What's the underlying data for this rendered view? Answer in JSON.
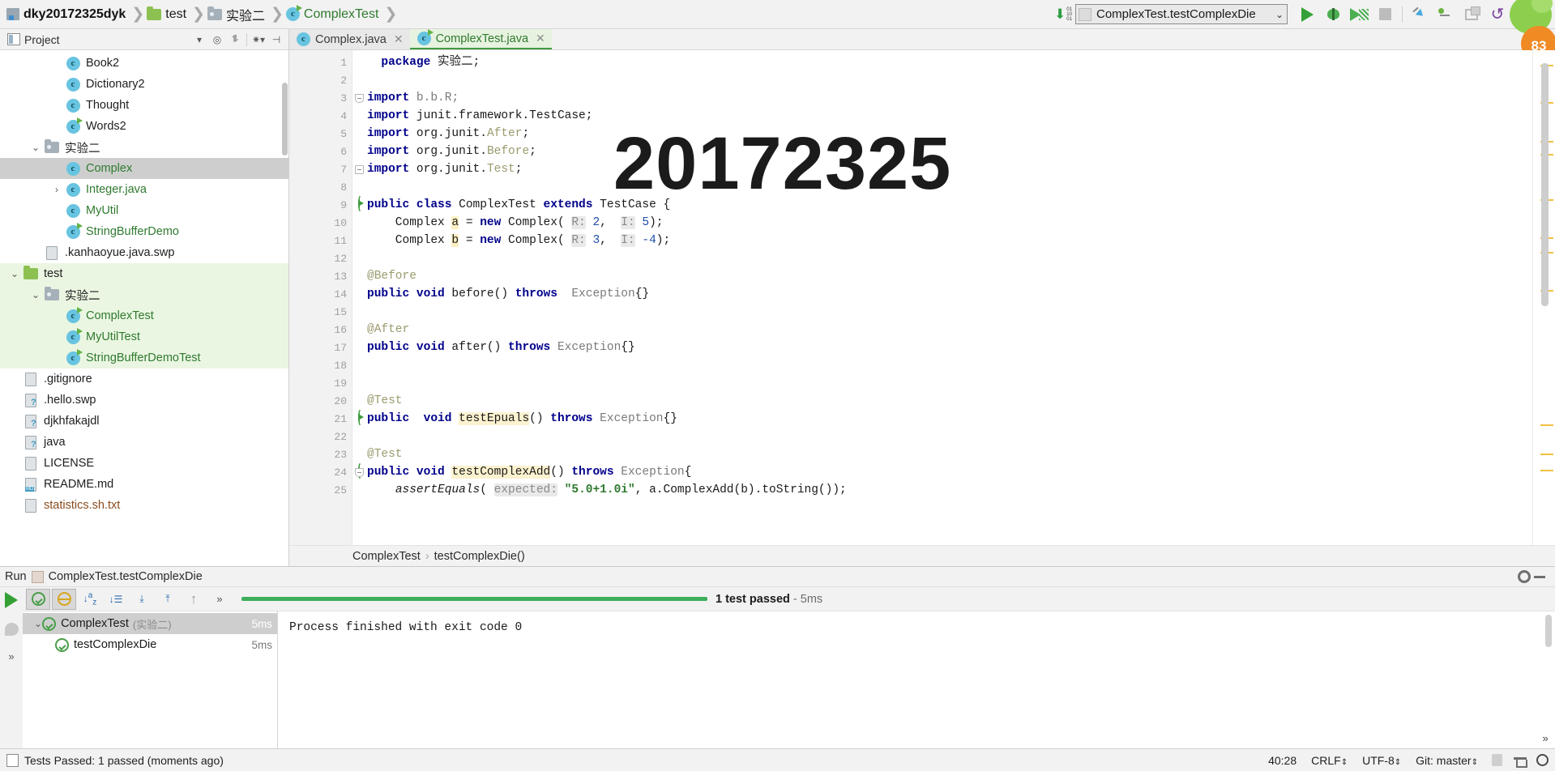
{
  "breadcrumb": [
    {
      "label": "dky20172325dyk",
      "icon": "module-icon",
      "style": "project"
    },
    {
      "label": "test",
      "icon": "folder-green-icon",
      "style": "plain"
    },
    {
      "label": "实验二",
      "icon": "folder-grey-icon",
      "style": "plain"
    },
    {
      "label": "ComplexTest",
      "icon": "class-test-icon",
      "style": "green"
    }
  ],
  "toolbar": {
    "binary_icon": "binary-download-icon",
    "run_config": "ComplexTest.testComplexDie",
    "run_config_caret": "⌄",
    "buttons": [
      {
        "name": "run-button",
        "icon": "play-icon"
      },
      {
        "name": "debug-button",
        "icon": "bug-icon"
      },
      {
        "name": "run-with-coverage-button",
        "icon": "coverage-icon"
      },
      {
        "name": "stop-button",
        "icon": "stop-icon"
      },
      {
        "name": "step-into-button",
        "icon": "step-into-icon"
      },
      {
        "name": "step-out-button",
        "icon": "step-out-icon"
      },
      {
        "name": "restore-layout-button",
        "icon": "window-stack-icon"
      },
      {
        "name": "undo-button",
        "icon": "undo-icon"
      },
      {
        "name": "search-everywhere-button",
        "icon": "search-doc-icon"
      }
    ],
    "mascot_badge": "83"
  },
  "sidebar": {
    "title": "Project",
    "title_caret": "▾",
    "actions": [
      "locate-icon",
      "collapse-all-icon",
      "settings-icon",
      "hide-icon"
    ],
    "tree": [
      {
        "label": "Book2",
        "icon": "class-icon",
        "indent": 3,
        "color": "dark",
        "chevron": ""
      },
      {
        "label": "Dictionary2",
        "icon": "class-icon",
        "indent": 3,
        "color": "dark",
        "chevron": ""
      },
      {
        "label": "Thought",
        "icon": "class-icon",
        "indent": 3,
        "color": "dark",
        "chevron": ""
      },
      {
        "label": "Words2",
        "icon": "class-test-icon",
        "indent": 3,
        "color": "dark",
        "chevron": ""
      },
      {
        "label": "实验二",
        "icon": "folder-grey-icon",
        "indent": 2,
        "color": "dark",
        "chevron": "v"
      },
      {
        "label": "Complex",
        "icon": "class-icon",
        "indent": 3,
        "color": "green",
        "chevron": "",
        "selected": true
      },
      {
        "label": "Integer.java",
        "icon": "class-icon",
        "indent": 3,
        "color": "green",
        "chevron": ">"
      },
      {
        "label": "MyUtil",
        "icon": "class-icon",
        "indent": 3,
        "color": "green",
        "chevron": ""
      },
      {
        "label": "StringBufferDemo",
        "icon": "class-test-icon",
        "indent": 3,
        "color": "green",
        "chevron": ""
      },
      {
        "label": ".kanhaoyue.java.swp",
        "icon": "file-icon",
        "indent": 2,
        "color": "dark",
        "chevron": ""
      },
      {
        "label": "test",
        "icon": "folder-green-icon",
        "indent": 1,
        "color": "dark",
        "chevron": "v",
        "testbg": true
      },
      {
        "label": "实验二",
        "icon": "folder-grey-icon",
        "indent": 2,
        "color": "dark",
        "chevron": "v",
        "testbg": true
      },
      {
        "label": "ComplexTest",
        "icon": "class-test-icon",
        "indent": 3,
        "color": "green",
        "chevron": "",
        "testbg": true
      },
      {
        "label": "MyUtilTest",
        "icon": "class-test-icon",
        "indent": 3,
        "color": "green",
        "chevron": "",
        "testbg": true
      },
      {
        "label": "StringBufferDemoTest",
        "icon": "class-test-icon",
        "indent": 3,
        "color": "green",
        "chevron": "",
        "testbg": true
      },
      {
        "label": ".gitignore",
        "icon": "file-icon",
        "indent": 1,
        "color": "dark",
        "chevron": ""
      },
      {
        "label": ".hello.swp",
        "icon": "file-unknown-icon",
        "indent": 1,
        "color": "dark",
        "chevron": ""
      },
      {
        "label": "djkhfakajdl",
        "icon": "file-unknown-icon",
        "indent": 1,
        "color": "dark",
        "chevron": ""
      },
      {
        "label": "java",
        "icon": "file-unknown-icon",
        "indent": 1,
        "color": "dark",
        "chevron": ""
      },
      {
        "label": "LICENSE",
        "icon": "file-icon",
        "indent": 1,
        "color": "dark",
        "chevron": ""
      },
      {
        "label": "README.md",
        "icon": "file-md-icon",
        "indent": 1,
        "color": "dark",
        "chevron": ""
      },
      {
        "label": "statistics.sh.txt",
        "icon": "file-icon",
        "indent": 1,
        "color": "brown",
        "chevron": ""
      }
    ]
  },
  "editor": {
    "tabs": [
      {
        "label": "Complex.java",
        "icon": "class-icon",
        "active": false,
        "close": "✕"
      },
      {
        "label": "ComplexTest.java",
        "icon": "class-test-icon",
        "active": true,
        "close": "✕"
      }
    ],
    "watermark": "20172325",
    "line_numbers": [
      "1",
      "2",
      "3",
      "4",
      "5",
      "6",
      "7",
      "8",
      "9",
      "10",
      "11",
      "12",
      "13",
      "14",
      "15",
      "16",
      "17",
      "18",
      "19",
      "20",
      "21",
      "22",
      "23",
      "24",
      "25"
    ],
    "lines": [
      {
        "n": 1,
        "html": "  <span class='kw'>package</span> 实验二;"
      },
      {
        "n": 2,
        "html": ""
      },
      {
        "n": 3,
        "html": "<span class='kw'>import</span> <span class='dim'>b.b.R</span><span class='dim'>;</span>",
        "fold": "start"
      },
      {
        "n": 4,
        "html": "<span class='kw'>import</span> junit.framework.TestCase;"
      },
      {
        "n": 5,
        "html": "<span class='kw'>import</span> org.junit.<span class='ann'>After</span>;"
      },
      {
        "n": 6,
        "html": "<span class='kw'>import</span> org.junit.<span class='ann'>Before</span>;"
      },
      {
        "n": 7,
        "html": "<span class='kw'>import</span> org.junit.<span class='ann'>Test</span>;",
        "fold": "end"
      },
      {
        "n": 8,
        "html": ""
      },
      {
        "n": 9,
        "html": "<span class='kw'>public class</span> ComplexTest <span class='kw'>extends</span> TestCase {",
        "run": true
      },
      {
        "n": 10,
        "html": "    Complex <span class='hl'>a</span> = <span class='kw'>new</span> Complex( <span class='param'>R:</span> <span class='num'>2</span>,  <span class='param'>I:</span> <span class='num'>5</span>);"
      },
      {
        "n": 11,
        "html": "    Complex <span class='hl'>b</span> = <span class='kw'>new</span> Complex( <span class='param'>R:</span> <span class='num'>3</span>,  <span class='param'>I:</span> <span class='num'>-4</span>);"
      },
      {
        "n": 12,
        "html": ""
      },
      {
        "n": 13,
        "html": "<span class='ann'>@Before</span>"
      },
      {
        "n": 14,
        "html": "<span class='kw'>public void</span> before() <span class='kw'>throws</span>  <span class='dim'>Exception</span>{}"
      },
      {
        "n": 15,
        "html": ""
      },
      {
        "n": 16,
        "html": "<span class='ann'>@After</span>"
      },
      {
        "n": 17,
        "html": "<span class='kw'>public void</span> after() <span class='kw'>throws</span> <span class='dim'>Exception</span>{}"
      },
      {
        "n": 18,
        "html": ""
      },
      {
        "n": 19,
        "html": ""
      },
      {
        "n": 20,
        "html": "<span class='ann'>@Test</span>"
      },
      {
        "n": 21,
        "html": "<span class='kw'>public  void</span> <span class='hl2'>testEpuals</span>() <span class='kw'>throws</span> <span class='dim'>Exception</span>{}",
        "run": true
      },
      {
        "n": 22,
        "html": ""
      },
      {
        "n": 23,
        "html": "<span class='ann'>@Test</span>"
      },
      {
        "n": 24,
        "html": "<span class='kw'>public void</span> <span class='hl2'>testComplexAdd</span>() <span class='kw'>throws</span> <span class='dim'>Exception</span>{",
        "run": true,
        "fold": "start"
      },
      {
        "n": 25,
        "html": "    <span class='ital'>assertEquals</span>( <span class='param'>expected:</span> <span class='str'>\"5.0+1.0i\"</span>, a.ComplexAdd(b).toString());"
      }
    ],
    "breadcrumb_bottom": [
      "ComplexTest",
      "testComplexDie()"
    ]
  },
  "run_panel": {
    "title": "Run",
    "config_name": "ComplexTest.testComplexDie",
    "toolbar_icons": [
      "rerun-icon",
      "show-passed-icon",
      "show-ignored-icon",
      "sort-alpha-icon",
      "sort-duration-icon",
      "expand-all-icon",
      "collapse-all-icon",
      "prev-test-icon",
      "more-icon"
    ],
    "status_text": "1 test passed",
    "status_time": "- 5ms",
    "tests": [
      {
        "label": "ComplexTest",
        "suffix": "(实验二)",
        "time": "5ms",
        "indent": 1,
        "selected": true,
        "chevron": "v"
      },
      {
        "label": "testComplexDie",
        "suffix": "",
        "time": "5ms",
        "indent": 2,
        "selected": false,
        "chevron": ""
      }
    ],
    "console": "Process finished with exit code 0",
    "settings_icon": "gear-icon",
    "hide_icon": "hide-icon",
    "more_icon": "»"
  },
  "status_bar": {
    "message": "Tests Passed: 1 passed (moments ago)",
    "position": "40:28",
    "line_sep": "CRLF",
    "encoding": "UTF-8",
    "branch": "Git: master",
    "caret_glyph": "⇕",
    "icons": [
      "lock-icon",
      "inspector-icon",
      "search-icon"
    ]
  }
}
